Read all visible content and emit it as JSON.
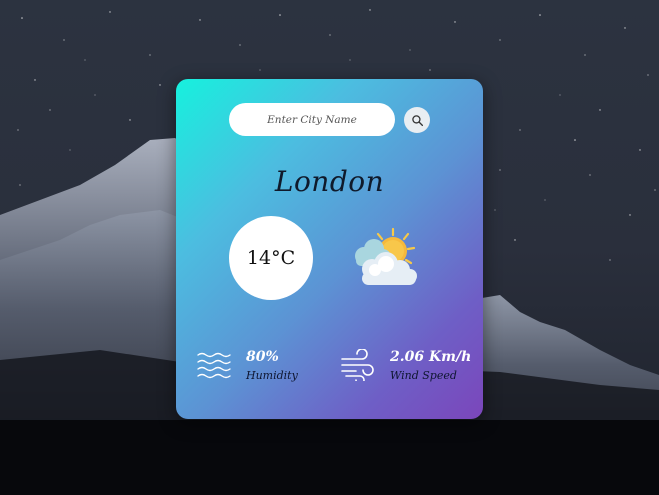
{
  "background": {
    "sky_color": "#2a3140",
    "ground_color": "#0b0d14"
  },
  "card": {
    "gradient_start": "#16f1de",
    "gradient_end": "#7b46bb"
  },
  "search": {
    "placeholder": "Enter City Name",
    "value": "",
    "button_icon": "search-icon"
  },
  "weather": {
    "city": "London",
    "temperature": "14°C",
    "condition_icon": "sun-behind-cloud-icon"
  },
  "humidity": {
    "value": "80%",
    "label": "Humidity",
    "icon": "water-waves-icon"
  },
  "wind": {
    "value": "2.06 Km/h",
    "label": "Wind Speed",
    "icon": "wind-icon"
  }
}
